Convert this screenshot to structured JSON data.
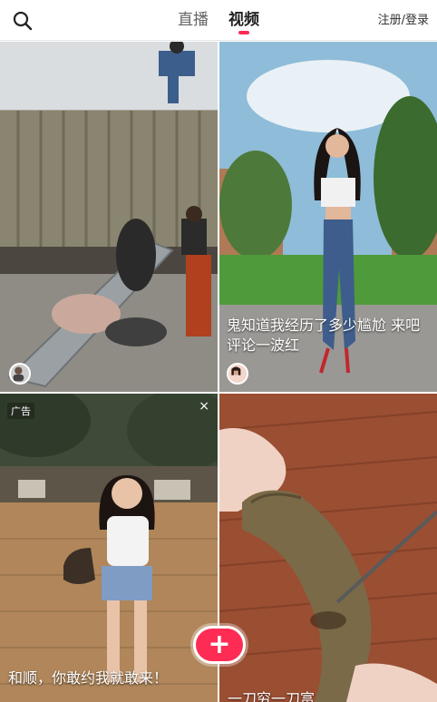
{
  "header": {
    "tabs": [
      {
        "label": "直播"
      },
      {
        "label": "视频"
      }
    ],
    "login": "注册/登录",
    "search_icon": "search-icon"
  },
  "feed": {
    "cards": [
      {
        "caption": ""
      },
      {
        "caption": "鬼知道我经历了多少尴尬 来吧 评论一波红"
      },
      {
        "ad_label": "广告",
        "ad_close": "×",
        "caption": "和顺，你敢约我就敢来！"
      },
      {
        "caption": "一刀穷一刀富"
      }
    ]
  },
  "fab": {
    "icon": "plus-icon",
    "label": "+"
  },
  "colors": {
    "accent": "#fe2c55"
  }
}
